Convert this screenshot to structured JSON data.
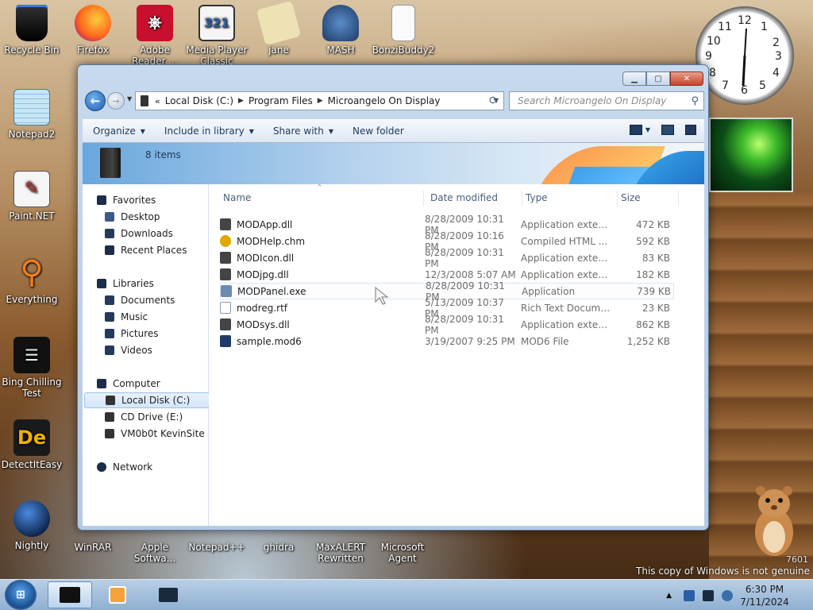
{
  "desktop_icons": [
    {
      "label": "Recycle Bin",
      "icon": "recycle-bin-icon",
      "color": "#111111"
    },
    {
      "label": "Firefox",
      "icon": "firefox-icon",
      "color": "#e66000"
    },
    {
      "label": "Adobe Reader ...",
      "icon": "adobe-reader-icon",
      "color": "#c8102e"
    },
    {
      "label": "Media Player Classic",
      "icon": "media-player-classic-icon",
      "color": "#f0f0f0"
    },
    {
      "label": "jane",
      "icon": "jane-icon",
      "color": "#e8e0b0"
    },
    {
      "label": "MASH",
      "icon": "mash-icon",
      "color": "#3a6ea8"
    },
    {
      "label": "BonziBuddy2",
      "icon": "bonzibuddy-icon",
      "color": "#ffffff"
    },
    {
      "label": "Notepad2",
      "icon": "notepad2-icon",
      "color": "#9ad0ea"
    },
    {
      "label": "Paint.NET",
      "icon": "paint-net-icon",
      "color": "#3b5ea8"
    },
    {
      "label": "Everything",
      "icon": "everything-icon",
      "color": "#f07e1a"
    },
    {
      "label": "Bing Chilling Test",
      "icon": "bing-chilling-icon",
      "color": "#1b1b1b"
    },
    {
      "label": "DetectItEasy",
      "icon": "detect-it-easy-icon",
      "color": "#f0b000"
    },
    {
      "label": "Nightly",
      "icon": "nightly-icon",
      "color": "#1a3a6e"
    },
    {
      "label": "WinRAR",
      "icon": "winrar-icon",
      "color": "#7a3a9a"
    },
    {
      "label": "Apple Softwa...",
      "icon": "apple-software-update-icon",
      "color": "#4a90d9"
    },
    {
      "label": "Notepad++",
      "icon": "notepad-plus-plus-icon",
      "color": "#8fc34a"
    },
    {
      "label": "ghidra",
      "icon": "ghidra-icon",
      "color": "#c0392b"
    },
    {
      "label": "MaxALERT Rewritten",
      "icon": "maxalert-icon",
      "color": "#3a6ea8"
    },
    {
      "label": "Microsoft Agent",
      "icon": "microsoft-agent-icon",
      "color": "#8a4a9a"
    }
  ],
  "window": {
    "breadcrumbs": [
      "Local Disk (C:)",
      "Program Files",
      "Microangelo On Display"
    ],
    "search_placeholder": "Search Microangelo On Display",
    "toolbar": {
      "organize": "Organize",
      "include_in_library": "Include in library",
      "share_with": "Share with",
      "new_folder": "New folder"
    },
    "item_count": "8 items",
    "nav": {
      "favorites": "Favorites",
      "desktop": "Desktop",
      "downloads": "Downloads",
      "recent_places": "Recent Places",
      "libraries": "Libraries",
      "documents": "Documents",
      "music": "Music",
      "pictures": "Pictures",
      "videos": "Videos",
      "computer": "Computer",
      "local_disk": "Local Disk (C:)",
      "cd_drive": "CD Drive (E:)",
      "vm_share": "VM0b0t KevinSite",
      "network": "Network"
    },
    "columns": {
      "name": "Name",
      "date": "Date modified",
      "type": "Type",
      "size": "Size"
    },
    "files": [
      {
        "name": "MODApp.dll",
        "date": "8/28/2009 10:31 PM",
        "type": "Application extens...",
        "size": "472 KB",
        "color": "#444444"
      },
      {
        "name": "MODHelp.chm",
        "date": "8/28/2009 10:16 PM",
        "type": "Compiled HTML ...",
        "size": "592 KB",
        "color": "#e0a800"
      },
      {
        "name": "MODIcon.dll",
        "date": "8/28/2009 10:31 PM",
        "type": "Application extens...",
        "size": "83 KB",
        "color": "#444444"
      },
      {
        "name": "MODjpg.dll",
        "date": "12/3/2008 5:07 AM",
        "type": "Application extens...",
        "size": "182 KB",
        "color": "#444444"
      },
      {
        "name": "MODPanel.exe",
        "date": "8/28/2009 10:31 PM",
        "type": "Application",
        "size": "739 KB",
        "color": "#6a8ab0"
      },
      {
        "name": "modreg.rtf",
        "date": "5/13/2009 10:37 PM",
        "type": "Rich Text Docume...",
        "size": "23 KB",
        "color": "#dfe6ef"
      },
      {
        "name": "MODsys.dll",
        "date": "8/28/2009 10:31 PM",
        "type": "Application extens...",
        "size": "862 KB",
        "color": "#444444"
      },
      {
        "name": "sample.mod6",
        "date": "3/19/2007 9:25 PM",
        "type": "MOD6 File",
        "size": "1,252 KB",
        "color": "#1e3a66"
      }
    ]
  },
  "clock_gadget": {
    "numbers": [
      "12",
      "1",
      "2",
      "3",
      "4",
      "5",
      "6",
      "7",
      "8",
      "9",
      "10",
      "11"
    ]
  },
  "taskbar": {
    "time": "6:30 PM",
    "date": "7/11/2024"
  },
  "watermark": {
    "text": "This copy of Windows is not genuine",
    "build": "7601"
  }
}
